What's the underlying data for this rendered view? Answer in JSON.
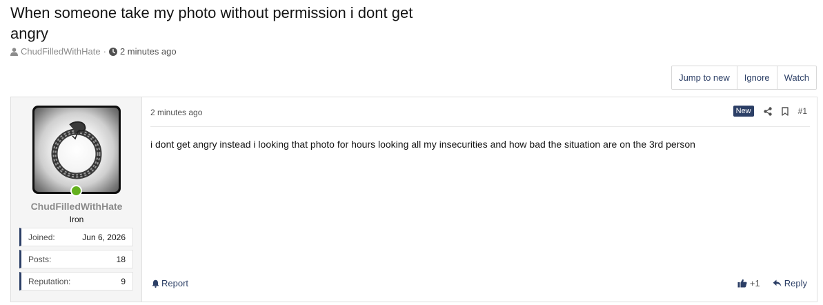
{
  "thread": {
    "title": "When someone take my photo without permission i dont get angry",
    "author": "ChudFilledWithHate",
    "separator": "·",
    "time": "2 minutes ago"
  },
  "toolbar": {
    "jump_label": "Jump to new",
    "ignore_label": "Ignore",
    "watch_label": "Watch"
  },
  "user": {
    "name": "ChudFilledWithHate",
    "title": "Iron",
    "online": true,
    "stats": [
      {
        "label": "Joined:",
        "value": "Jun 6, 2026"
      },
      {
        "label": "Posts:",
        "value": "18"
      },
      {
        "label": "Reputation:",
        "value": "9"
      }
    ]
  },
  "post": {
    "date": "2 minutes ago",
    "badge": "New",
    "number": "#1",
    "body": "i dont get angry instead i looking that photo for hours looking all my insecurities and how bad the situation are on the 3rd person",
    "report_label": "Report",
    "reaction_count": "+1",
    "reply_label": "Reply"
  },
  "colors": {
    "accent": "#2c3f66",
    "online": "#63b01d",
    "muted": "#8b8b8b"
  },
  "icons": [
    "user-icon",
    "clock-icon",
    "share-icon",
    "bookmark-icon",
    "bell-icon",
    "thumbs-up-icon",
    "reply-icon"
  ]
}
